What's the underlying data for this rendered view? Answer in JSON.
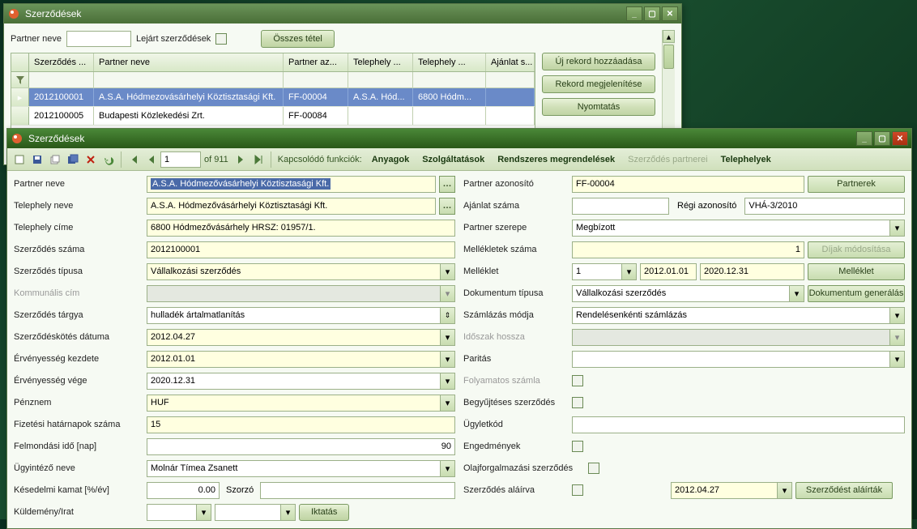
{
  "topWindow": {
    "title": "Szerződések",
    "filter": {
      "partnerLabel": "Partner neve",
      "expiredLabel": "Lejárt szerződések",
      "allItemsBtn": "Összes tétel"
    },
    "grid": {
      "columns": [
        "Szerződés ...",
        "Partner neve",
        "Partner az...",
        "Telephely ...",
        "Telephely ...",
        "Ajánlat s..."
      ],
      "rows": [
        {
          "id": "2012100001",
          "partner": "A.S.A. Hódmezovásárhelyi Köztisztasági Kft.",
          "paz": "FF-00004",
          "th": "A.S.A. Hód...",
          "thaddr": "6800 Hódm...",
          "ajanlat": ""
        },
        {
          "id": "2012100005",
          "partner": "Budapesti Közlekedési Zrt.",
          "paz": "FF-00084",
          "th": "",
          "thaddr": "",
          "ajanlat": ""
        }
      ]
    },
    "sideButtons": {
      "add": "Új rekord hozzáadása",
      "show": "Rekord megjelenítése",
      "print": "Nyomtatás"
    }
  },
  "detailWindow": {
    "title": "Szerződések",
    "toolbar": {
      "page": "1",
      "ofText": "of 911",
      "relatedLabel": "Kapcsolódó funkciók:",
      "links": {
        "materials": "Anyagok",
        "services": "Szolgáltatások",
        "regular": "Rendszeres megrendelések",
        "partners": "Szerződés partnerei",
        "sites": "Telephelyek"
      }
    },
    "left": {
      "partnerNeve": {
        "label": "Partner neve",
        "value": "A.S.A. Hódmezővásárhelyi Köztisztasági Kft."
      },
      "telephelyNeve": {
        "label": "Telephely neve",
        "value": "A.S.A. Hódmezővásárhelyi Köztisztasági Kft."
      },
      "telephelyCime": {
        "label": "Telephely címe",
        "value": "6800 Hódmezővásárhely HRSZ: 01957/1."
      },
      "szerzodesSzama": {
        "label": "Szerződés száma",
        "value": "2012100001"
      },
      "szerzodesTipusa": {
        "label": "Szerződés típusa",
        "value": "Vállalkozási szerződés"
      },
      "kommunalisCim": {
        "label": "Kommunális cím",
        "value": ""
      },
      "szerzodesTargya": {
        "label": "Szerződés tárgya",
        "value": "hulladék ártalmatlanítás"
      },
      "kotesDatuma": {
        "label": "Szerződéskötés dátuma",
        "value": "2012.04.27"
      },
      "ervKezdete": {
        "label": "Érvényesség kezdete",
        "value": "2012.01.01"
      },
      "ervVege": {
        "label": "Érvényesség vége",
        "value": "2020.12.31"
      },
      "penznem": {
        "label": "Pénznem",
        "value": "HUF"
      },
      "fizHatarnapok": {
        "label": "Fizetési határnapok száma",
        "value": "15"
      },
      "felmondasiIdo": {
        "label": "Felmondási idő [nap]",
        "value": "90"
      },
      "ugyintezo": {
        "label": "Ügyintéző neve",
        "value": "Molnár Tímea Zsanett"
      },
      "kesedelmiKamat": {
        "label": "Késedelmi kamat [%/év]",
        "value": "0.00"
      },
      "szorzoLabel": "Szorzó",
      "kuldemeny": {
        "label": "Küldemény/Irat"
      },
      "iktatasBtn": "Iktatás"
    },
    "right": {
      "partnerAzonosito": {
        "label": "Partner azonosító",
        "value": "FF-00004",
        "btn": "Partnerek"
      },
      "ajanlatSzama": {
        "label": "Ajánlat száma",
        "value": ""
      },
      "regiAzonosito": {
        "label": "Régi azonosító",
        "value": "VHÁ-3/2010"
      },
      "partnerSzerepe": {
        "label": "Partner szerepe",
        "value": "Megbízott"
      },
      "melleletekSzama": {
        "label": "Mellékletek száma",
        "value": "1",
        "btn": "Díjak módosítása"
      },
      "melleklet": {
        "label": "Melléklet",
        "idx": "1",
        "from": "2012.01.01",
        "to": "2020.12.31",
        "btn": "Melléklet"
      },
      "dokTipusa": {
        "label": "Dokumentum típusa",
        "value": "Vállalkozási szerződés",
        "btn": "Dokumentum generálás"
      },
      "szamlazasModja": {
        "label": "Számlázás módja",
        "value": "Rendelésenkénti számlázás"
      },
      "idoszakHossza": {
        "label": "Időszak hossza",
        "value": ""
      },
      "paritas": {
        "label": "Paritás",
        "value": ""
      },
      "folyamatosSzamla": {
        "label": "Folyamatos számla"
      },
      "begyujteses": {
        "label": "Begyűjtéses szerződés"
      },
      "ugyletkod": {
        "label": "Ügyletkód",
        "value": ""
      },
      "engedmenyek": {
        "label": "Engedmények"
      },
      "olajforgalmazasi": {
        "label": "Olajforgalmazási szerződés"
      },
      "alairva": {
        "label": "Szerződés aláírva",
        "date": "2012.04.27",
        "btn": "Szerződést aláírták"
      }
    }
  }
}
